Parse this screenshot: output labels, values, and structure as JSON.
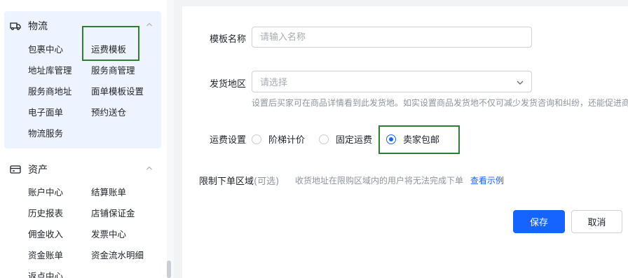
{
  "sidebar": {
    "logistics": {
      "title": "物流",
      "icon": "truck-icon",
      "items": [
        "包裹中心",
        "运费模板",
        "地址库管理",
        "服务商管理",
        "服务商地址",
        "面单模板设置",
        "电子面单",
        "预约送仓",
        "物流服务"
      ]
    },
    "assets": {
      "title": "资产",
      "icon": "wallet-icon",
      "items": [
        "账户中心",
        "结算账单",
        "历史报表",
        "店铺保证金",
        "佣金收入",
        "发票中心",
        "资金账单",
        "资金流水明细",
        "返点中心"
      ]
    },
    "active_color": "#eef4ff"
  },
  "form": {
    "template_name": {
      "label": "模板名称",
      "placeholder": "请输入名称",
      "value": ""
    },
    "ship_region": {
      "label": "发货地区",
      "placeholder": "请选择",
      "hint": "设置后买家可在商品详情看到此发货地。如实设置商品发货地不仅可减少发货咨询和纠纷，还能促进商"
    },
    "shipping_setting": {
      "label": "运费设置",
      "options": [
        "阶梯计价",
        "固定运费",
        "卖家包邮"
      ],
      "selected": "卖家包邮"
    },
    "restricted_area": {
      "label": "限制下单区域",
      "optional": "(可选)",
      "hint": "收货地址在限购区域内的用户将无法完成下单",
      "link": "查看示例"
    }
  },
  "actions": {
    "save": "保存",
    "cancel": "取消"
  },
  "colors": {
    "primary": "#1664ff",
    "highlight": "#2e7d32"
  }
}
